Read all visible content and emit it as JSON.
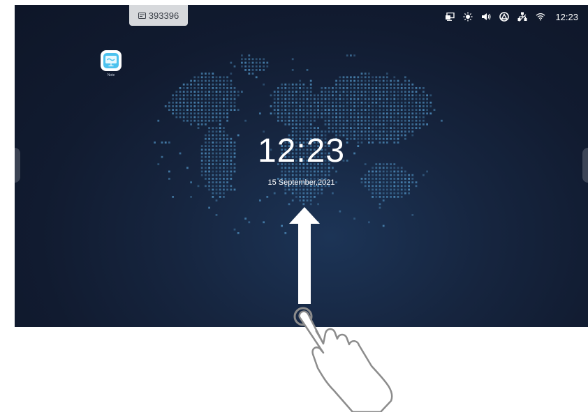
{
  "device": {
    "id_badge": {
      "text": "393396",
      "icon": "screen-id-icon"
    }
  },
  "status_bar": {
    "icons": [
      "cast-icon",
      "brightness-icon",
      "volume-icon",
      "eshare-icon",
      "ethernet-icon",
      "wifi-icon"
    ],
    "time": "12:23"
  },
  "desktop": {
    "apps": [
      {
        "label": "Note",
        "icon": "note-app-icon"
      }
    ]
  },
  "lockscreen": {
    "time": "12:23",
    "date": "15 September,2021"
  },
  "gesture": {
    "type": "swipe-up",
    "icons": [
      "arrow-up-icon",
      "hand-pointer-icon"
    ]
  },
  "colors": {
    "background": "#111b30",
    "globe_dots": "#4f8fbf",
    "text": "#ffffff"
  }
}
